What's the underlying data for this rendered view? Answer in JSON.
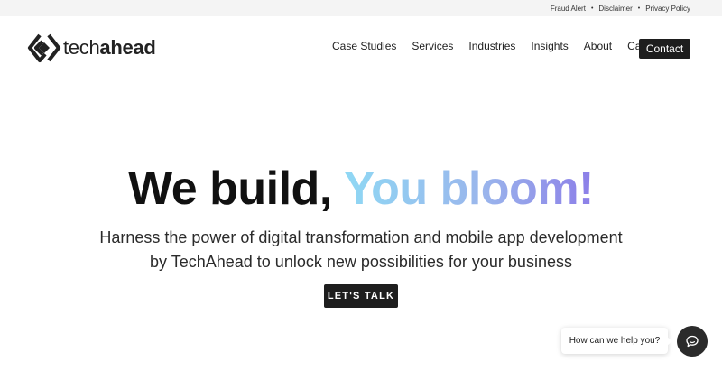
{
  "topbar": {
    "links": [
      "Fraud Alert",
      "Disclaimer",
      "Privacy Policy"
    ]
  },
  "logo": {
    "icon": "techahead-logo-icon",
    "text_light": "tech",
    "text_bold": "ahead"
  },
  "nav": {
    "items": [
      "Case Studies",
      "Services",
      "Industries",
      "Insights",
      "About",
      "Careers"
    ],
    "contact_label": "Contact"
  },
  "hero": {
    "title_plain": "We build, ",
    "title_accent": "You bloom!",
    "subtitle_line1": "Harness the power of digital transformation and mobile app development",
    "subtitle_line2": "by TechAhead to unlock new possibilities for your business",
    "cta_label": "LET'S TALK"
  },
  "chat": {
    "bubble_text": "How can we help you?",
    "icon": "chat-icon"
  },
  "colors": {
    "dark": "#1e1e1e",
    "accent_gradient_start": "#8fd8f4",
    "accent_gradient_end": "#8c7ee8"
  }
}
